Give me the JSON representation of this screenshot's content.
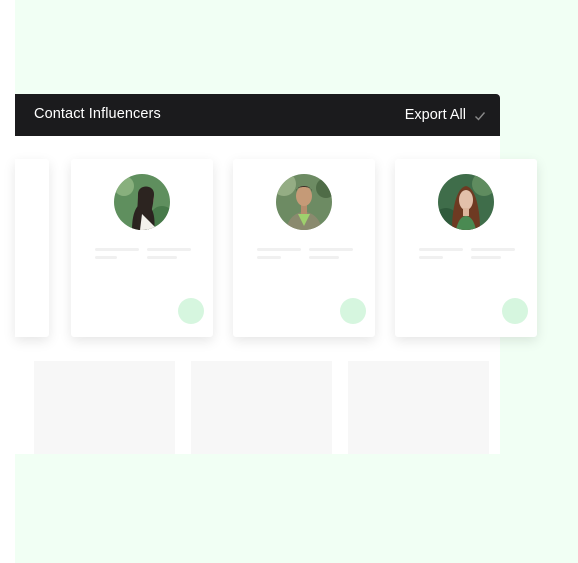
{
  "header": {
    "title": "Contact Influencers",
    "export_label": "Export All",
    "check_icon": "check-icon"
  },
  "colors": {
    "background_mint": "#f1fff4",
    "topbar": "#1b1b1d",
    "contact_dot": "#d6f6df"
  },
  "cards": [
    {
      "name": "partial-card"
    },
    {
      "name": "influencer-card-1",
      "avatar_icon": "avatar-woman-dark-hair"
    },
    {
      "name": "influencer-card-2",
      "avatar_icon": "avatar-man-shaved-head"
    },
    {
      "name": "influencer-card-3",
      "avatar_icon": "avatar-woman-auburn-hair"
    }
  ]
}
